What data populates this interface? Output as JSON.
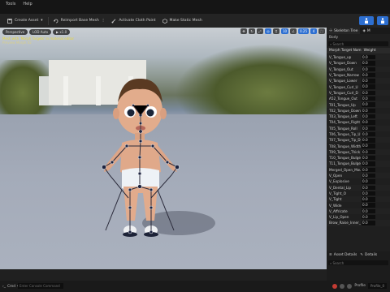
{
  "menu": {
    "items": [
      "Tools",
      "Help"
    ]
  },
  "toolbar": {
    "create_asset": "Create Asset",
    "reimport": "Reimport Base Mesh",
    "activate_cloth": "Activate Cloth Paint",
    "make_static": "Make Static Mesh"
  },
  "viewport": {
    "perspective": "Perspective",
    "lod_auto": "LOD Auto",
    "speed": "x1.0",
    "right_icons": [
      "10",
      "0.25",
      "4"
    ],
    "messages": [
      "Mesh with 'Morph Targets' in material editor",
      "Preview Morph 42"
    ]
  },
  "panel": {
    "tabs": [
      "Skeleton Tree",
      "M"
    ],
    "body_label": "Body",
    "search_placeholder": "Search",
    "col_name": "Morph Target Nam",
    "col_weight": "Weight",
    "rows": [
      {
        "name": "V_Tongue_up",
        "value": "0.0"
      },
      {
        "name": "V_Tongue_Down",
        "value": "0.0"
      },
      {
        "name": "V_Tongue_Out",
        "value": "0.0"
      },
      {
        "name": "V_Tongue_Narrow",
        "value": "0.0"
      },
      {
        "name": "V_Tongue_Lower",
        "value": "0.0"
      },
      {
        "name": "V_Tongue_Curl_U",
        "value": "0.0"
      },
      {
        "name": "V_Tongue_Curl_D",
        "value": "0.0"
      },
      {
        "name": "A52_Tongue_Out",
        "value": "0.0"
      },
      {
        "name": "T01_Tongue_Up",
        "value": "0.0"
      },
      {
        "name": "T02_Tongue_Down",
        "value": "0.0"
      },
      {
        "name": "T03_Tongue_Left",
        "value": "0.0"
      },
      {
        "name": "T04_Tongue_Right",
        "value": "0.0"
      },
      {
        "name": "T05_Tongue_Roll",
        "value": "0.0"
      },
      {
        "name": "T06_Tongue_Tip_U",
        "value": "0.0"
      },
      {
        "name": "T07_Tongue_Tip_D",
        "value": "0.0"
      },
      {
        "name": "T08_Tongue_Width",
        "value": "0.0"
      },
      {
        "name": "T09_Tongue_Thick",
        "value": "0.0"
      },
      {
        "name": "T10_Tongue_Bulge",
        "value": "0.0"
      },
      {
        "name": "T11_Tongue_Bulge",
        "value": "0.0"
      },
      {
        "name": "Merged_Open_Mout",
        "value": "0.0"
      },
      {
        "name": "V_Open",
        "value": "0.0"
      },
      {
        "name": "V_Explosive",
        "value": "0.0"
      },
      {
        "name": "V_Dental_Lip",
        "value": "0.0"
      },
      {
        "name": "V_Tight_O",
        "value": "0.0"
      },
      {
        "name": "V_Tight",
        "value": "0.0"
      },
      {
        "name": "V_Wide",
        "value": "0.0"
      },
      {
        "name": "V_Affricate",
        "value": "0.0"
      },
      {
        "name": "V_Lip_Open",
        "value": "0.0"
      },
      {
        "name": "Brow_Raise_Inner_L",
        "value": "0.0"
      }
    ],
    "bottom_tabs": [
      "Asset Details",
      "Details"
    ],
    "bottom_search": "Search"
  },
  "status": {
    "cmd_label": "Cmd",
    "cmd_placeholder": "Enter Console Command",
    "profile_label": "Profile",
    "profile_value": "Profile_0"
  }
}
